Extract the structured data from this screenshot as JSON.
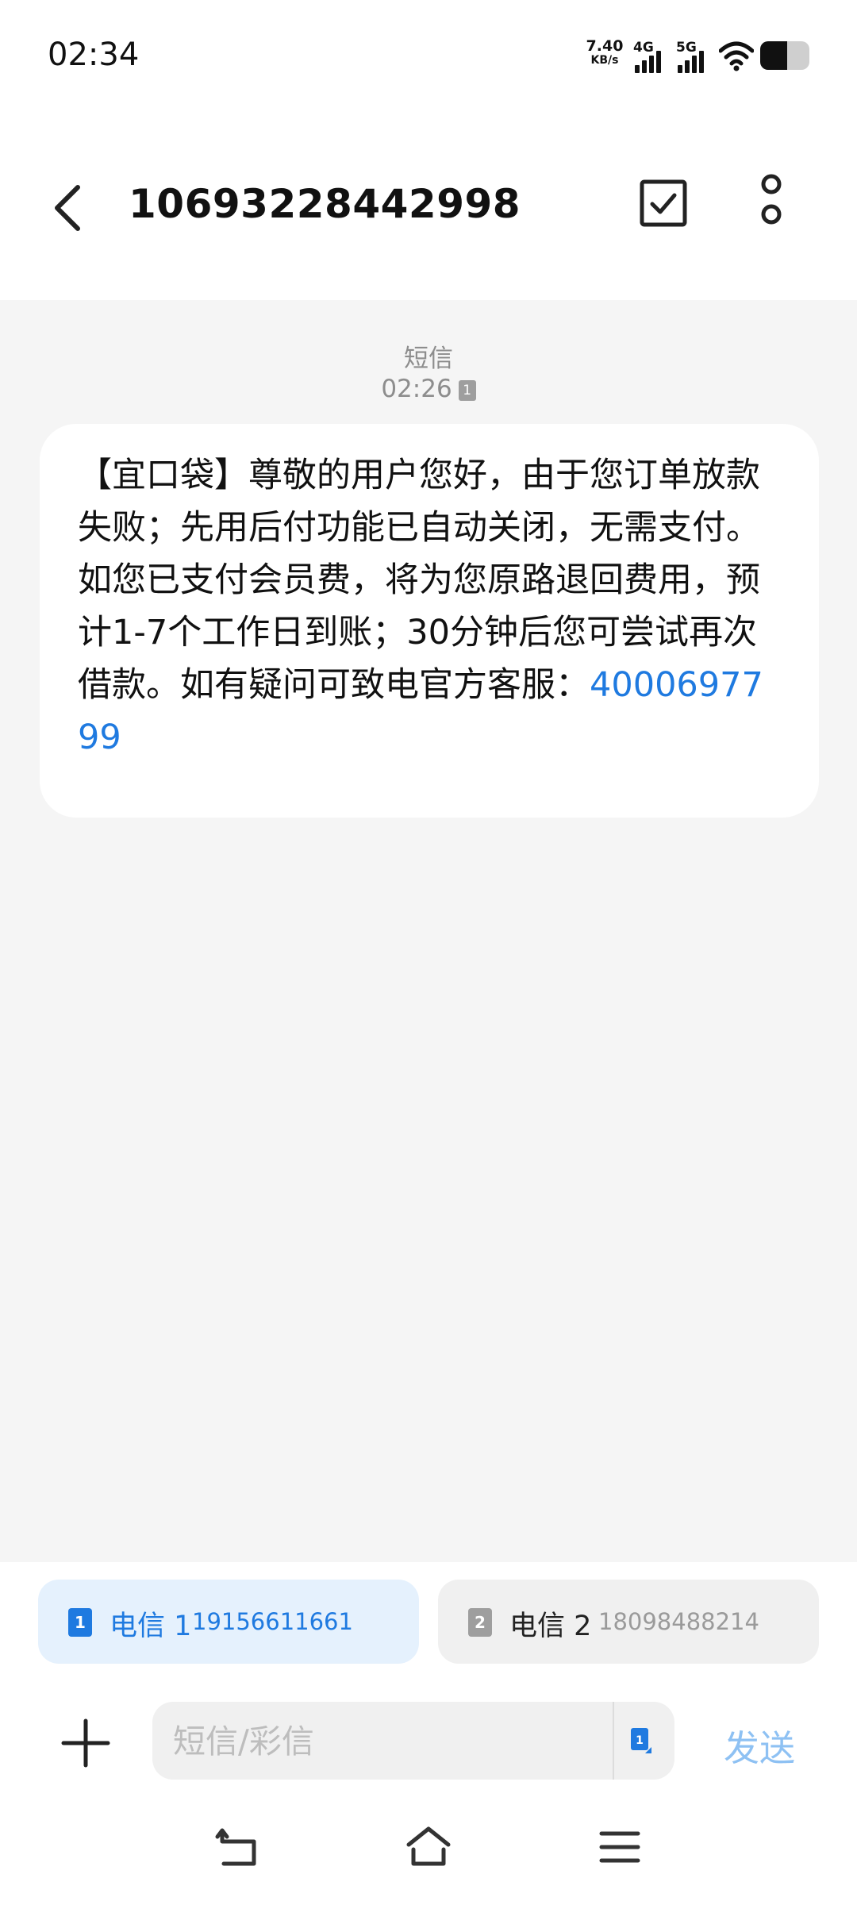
{
  "status_bar": {
    "time": "02:34",
    "net_speed_value": "7.40",
    "net_speed_unit": "KB/s",
    "sim1_network": "4G",
    "sim2_network": "5G",
    "battery_level": 0.55
  },
  "header": {
    "sender": "10693228442998"
  },
  "conversation": {
    "message_type": "短信",
    "timestamp": "02:26",
    "sim_badge": "1",
    "message_text": "【宜口袋】尊敬的用户您好，由于您订单放款失败；先用后付功能已自动关闭，无需支付。如您已支付会员费，将为您原路退回费用，预计1-7个工作日到账；30分钟后您可尝试再次借款。如有疑问可致电官方客服：",
    "message_phone": "4000697799"
  },
  "sim_selector": {
    "sim1": {
      "badge": "1",
      "name": "电信 1",
      "number": "19156611661",
      "selected": true
    },
    "sim2": {
      "badge": "2",
      "name": "电信 2",
      "number": "18098488214",
      "selected": false
    }
  },
  "composer": {
    "placeholder": "短信/彩信",
    "value": "",
    "send_label": "发送",
    "sim_badge": "1"
  },
  "colors": {
    "accent": "#1f7ae0",
    "send_disabled": "#8ec1f3",
    "conversation_bg": "#f5f5f5",
    "sim1_bg": "#e5f1fd"
  },
  "icons": {
    "back": "back-arrow-icon",
    "select": "checkbox-icon",
    "more": "more-vertical-icon",
    "attach": "plus-icon",
    "nav_back": "nav-back-icon",
    "nav_home": "nav-home-icon",
    "nav_menu": "nav-menu-icon"
  }
}
